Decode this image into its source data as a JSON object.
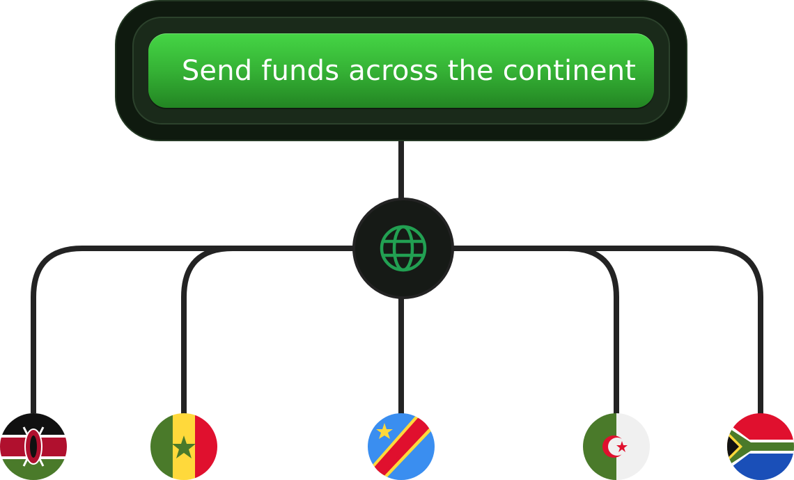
{
  "cta": {
    "label": "Send funds across the continent",
    "colors": {
      "button": "#35b235",
      "outer": "#0f1a0f",
      "mid": "#1a2a1a"
    }
  },
  "hub": {
    "icon": "globe-icon",
    "icon_color": "#22a052",
    "fill": "#161a16"
  },
  "connector_color": "#232323",
  "countries": [
    {
      "name": "Kenya",
      "icon": "kenya-flag-icon"
    },
    {
      "name": "Senegal",
      "icon": "senegal-flag-icon"
    },
    {
      "name": "DR Congo",
      "icon": "dr-congo-flag-icon"
    },
    {
      "name": "Algeria",
      "icon": "algeria-flag-icon"
    },
    {
      "name": "South Africa",
      "icon": "south-africa-flag-icon"
    }
  ]
}
